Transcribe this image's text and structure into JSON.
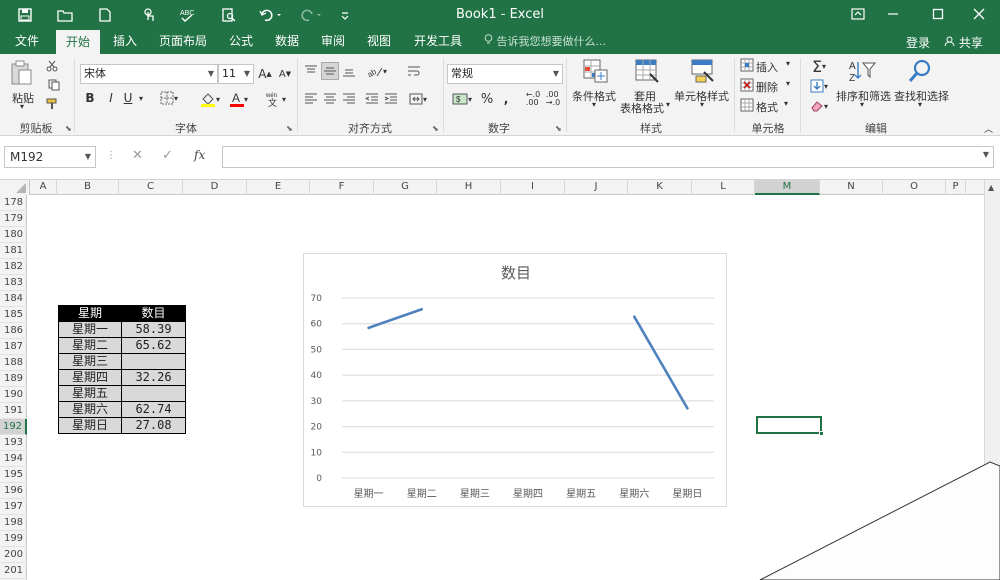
{
  "titlebar": {
    "title": "Book1 - Excel",
    "save_icon": "save-icon",
    "open_icon": "folder-icon",
    "new_icon": "new-file-icon",
    "touch_icon": "touch-icon",
    "spell_icon": "spelling-icon",
    "preview_icon": "print-preview-icon",
    "undo_icon": "undo-icon",
    "redo_icon": "redo-icon"
  },
  "tabs": [
    {
      "label": "文件"
    },
    {
      "label": "开始"
    },
    {
      "label": "插入"
    },
    {
      "label": "页面布局"
    },
    {
      "label": "公式"
    },
    {
      "label": "数据"
    },
    {
      "label": "审阅"
    },
    {
      "label": "视图"
    },
    {
      "label": "开发工具"
    }
  ],
  "tellme": "告诉我您想要做什么...",
  "login": "登录",
  "share": "共享",
  "ribbon": {
    "clipboard": {
      "label": "剪贴板",
      "paste": "粘贴"
    },
    "font": {
      "label": "字体",
      "name": "宋体",
      "size": "11",
      "bold": "B",
      "italic": "I",
      "underline": "U"
    },
    "alignment": {
      "label": "对齐方式"
    },
    "number": {
      "label": "数字",
      "format": "常规"
    },
    "styles": {
      "label": "样式",
      "conditional": "条件格式",
      "table_1": "套用",
      "table_2": "表格格式",
      "cell_styles": "单元格样式"
    },
    "cells": {
      "label": "单元格",
      "insert": "插入",
      "delete": "删除",
      "format": "格式"
    },
    "editing": {
      "label": "编辑",
      "sort": "排序和筛选",
      "find": "查找和选择"
    }
  },
  "formula": {
    "namebox": "M192",
    "value": ""
  },
  "columns": [
    "A",
    "B",
    "C",
    "D",
    "E",
    "F",
    "G",
    "H",
    "I",
    "J",
    "K",
    "L",
    "M",
    "N",
    "O",
    "P"
  ],
  "selected_column": "M",
  "rows": [
    "178",
    "179",
    "180",
    "181",
    "182",
    "183",
    "184",
    "185",
    "186",
    "187",
    "188",
    "189",
    "190",
    "191",
    "192",
    "193",
    "194",
    "195",
    "196",
    "197",
    "198",
    "199",
    "200",
    "201"
  ],
  "selected_row": "192",
  "table": {
    "header": [
      "星期",
      "数目"
    ],
    "rows": [
      [
        "星期一",
        "58.39"
      ],
      [
        "星期二",
        "65.62"
      ],
      [
        "星期三",
        ""
      ],
      [
        "星期四",
        "32.26"
      ],
      [
        "星期五",
        ""
      ],
      [
        "星期六",
        "62.74"
      ],
      [
        "星期日",
        "27.08"
      ]
    ]
  },
  "chart_data": {
    "type": "line",
    "title": "数目",
    "categories": [
      "星期一",
      "星期二",
      "星期三",
      "星期四",
      "星期五",
      "星期六",
      "星期日"
    ],
    "values": [
      58.39,
      65.62,
      null,
      32.26,
      null,
      62.74,
      27.08
    ],
    "visible_segments": [
      [
        0,
        1
      ],
      [
        5,
        6
      ]
    ],
    "ylim": [
      0,
      70
    ],
    "yticks": [
      0,
      10,
      20,
      30,
      40,
      50,
      60,
      70
    ],
    "grid": true,
    "line_color": "#4f81bd",
    "grid_color": "#d9d9d9"
  },
  "colors": {
    "accent": "#217346"
  }
}
